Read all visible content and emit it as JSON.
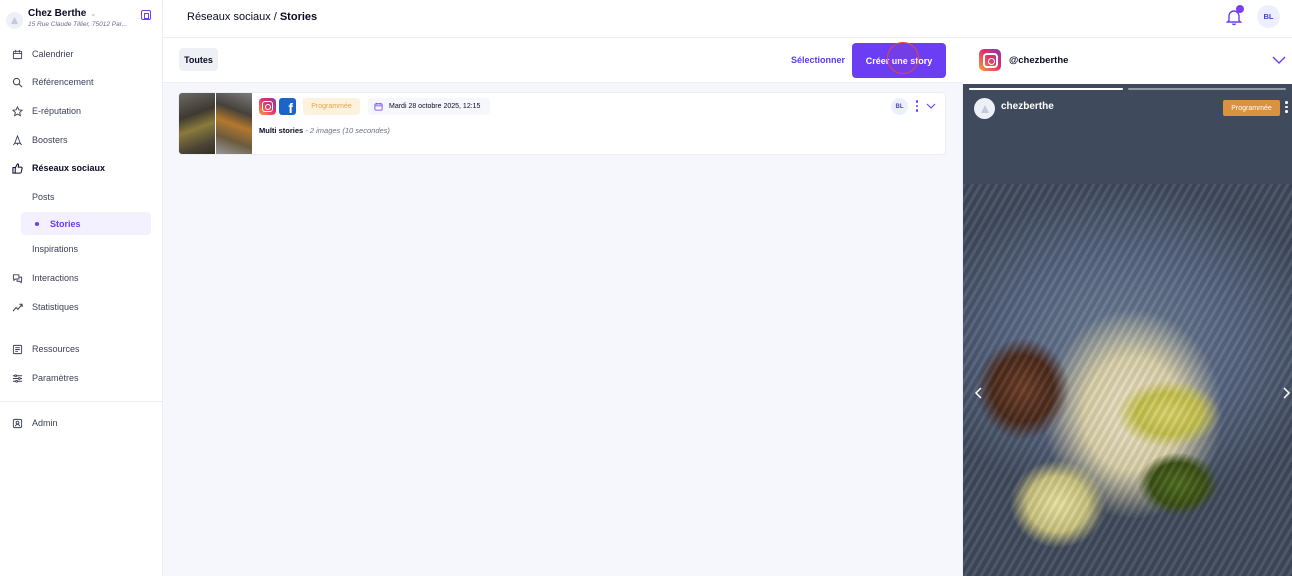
{
  "sidebar": {
    "brand": {
      "name": "Chez Berthe",
      "chevron": "⌄",
      "address": "15 Rue Claude Tillier, 75012 Par..."
    },
    "items": [
      {
        "label": "Calendrier",
        "icon": "calendar-icon"
      },
      {
        "label": "Référencement",
        "icon": "search-icon"
      },
      {
        "label": "E-réputation",
        "icon": "star-icon"
      },
      {
        "label": "Boosters",
        "icon": "rocket-icon"
      },
      {
        "label": "Réseaux sociaux",
        "icon": "thumbs-up-icon"
      },
      {
        "label": "Interactions",
        "icon": "chat-icon"
      },
      {
        "label": "Statistiques",
        "icon": "trend-icon"
      },
      {
        "label": "Ressources",
        "icon": "resources-icon"
      },
      {
        "label": "Paramètres",
        "icon": "sliders-icon"
      },
      {
        "label": "Admin",
        "icon": "admin-icon"
      }
    ],
    "subitems": [
      {
        "label": "Posts"
      },
      {
        "label": "Stories",
        "active": true
      },
      {
        "label": "Inspirations"
      }
    ]
  },
  "topbar": {
    "breadcrumb_parent": "Réseaux sociaux",
    "breadcrumb_sep": "/",
    "breadcrumb_current": "Stories",
    "avatar_initials": "BL"
  },
  "toolbar": {
    "filter_tab": "Toutes",
    "select_label": "Sélectionner",
    "create_label": "Créer une story"
  },
  "story_card": {
    "status": "Programmée",
    "date": "Mardi 28 octobre 2025, 12:15",
    "title": "Multi stories",
    "detail": "- 2 images (10 secondes)",
    "avatar_initials": "BL",
    "fb_glyph": "f"
  },
  "preview": {
    "account_handle": "@chezberthe",
    "story_user": "chezberthe",
    "story_status": "Programmée",
    "progress": [
      1,
      0
    ]
  },
  "colors": {
    "accent": "#6b3df3",
    "status_bg": "#fdf2dd",
    "status_text": "#e8a44a",
    "bell_dot": "#7b3ff2"
  }
}
